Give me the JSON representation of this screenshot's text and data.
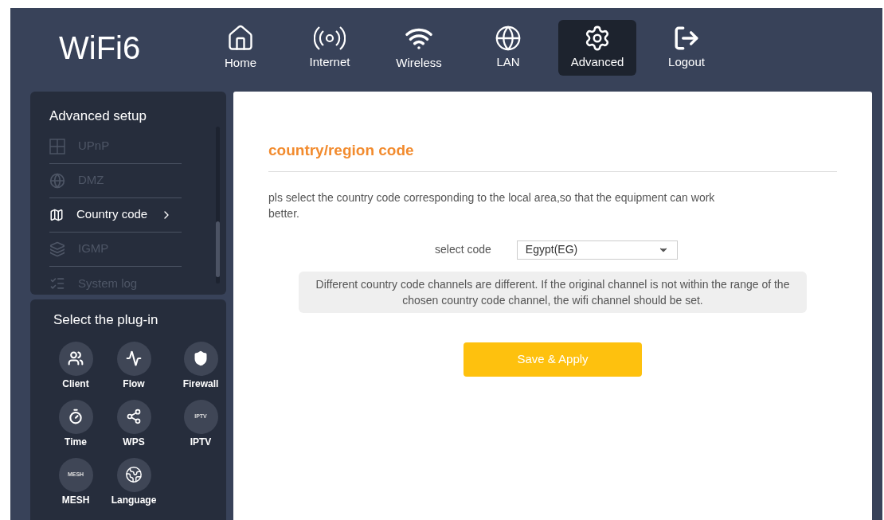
{
  "brand": "WiFi6",
  "nav": [
    {
      "label": "Home",
      "selected": false
    },
    {
      "label": "Internet",
      "selected": false
    },
    {
      "label": "Wireless",
      "selected": false
    },
    {
      "label": "LAN",
      "selected": false
    },
    {
      "label": "Advanced",
      "selected": true
    },
    {
      "label": "Logout",
      "selected": false
    }
  ],
  "sidebar": {
    "title": "Advanced setup",
    "items": [
      {
        "label": "UPnP",
        "selected": false
      },
      {
        "label": "DMZ",
        "selected": false
      },
      {
        "label": "Country code",
        "selected": true
      },
      {
        "label": "IGMP",
        "selected": false
      },
      {
        "label": "System log",
        "selected": false
      }
    ]
  },
  "plugins": {
    "title": "Select the plug-in",
    "items": [
      {
        "label": "Client"
      },
      {
        "label": "Flow"
      },
      {
        "label": "Firewall"
      },
      {
        "label": "Time"
      },
      {
        "label": "WPS"
      },
      {
        "label": "IPTV",
        "badge": "IPTV"
      },
      {
        "label": "MESH",
        "badge": "MESH"
      },
      {
        "label": "Language"
      }
    ]
  },
  "content": {
    "title": "country/region code",
    "description": "pls select the country code corresponding to the local area,so that the equipment can work better.",
    "select_label": "select code",
    "select_value": "Egypt(EG)",
    "notice": "Different country code channels are different. If the original channel is not within the range of the chosen country code channel, the wifi channel should be set.",
    "button": "Save & Apply"
  }
}
